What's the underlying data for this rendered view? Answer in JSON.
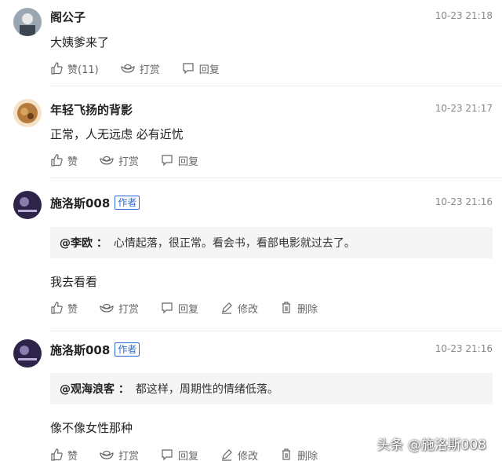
{
  "comments": [
    {
      "user": "阁公子",
      "time": "10-23 21:18",
      "text": "大姨爹来了",
      "actions": {
        "like": "赞(11)",
        "tip": "打赏",
        "reply": "回复"
      }
    },
    {
      "user": "年轻飞扬的背影",
      "time": "10-23 21:17",
      "text": "正常，人无远虑 必有近忧",
      "actions": {
        "like": "赞",
        "tip": "打赏",
        "reply": "回复"
      }
    },
    {
      "user": "施洛斯008",
      "badge": "作者",
      "time": "10-23 21:16",
      "quote_user": "@李欧 ：",
      "quote_text": "心情起落，很正常。看会书，看部电影就过去了。",
      "text": "我去看看",
      "actions": {
        "like": "赞",
        "tip": "打赏",
        "reply": "回复",
        "edit": "修改",
        "delete": "删除"
      }
    },
    {
      "user": "施洛斯008",
      "badge": "作者",
      "time": "10-23 21:16",
      "quote_user": "@观海浪客 ：",
      "quote_text": "都这样，周期性的情绪低落。",
      "text": "像不像女性那种",
      "actions": {
        "like": "赞",
        "tip": "打赏",
        "reply": "回复",
        "edit": "修改",
        "delete": "删除"
      }
    }
  ],
  "watermark": "头条 @施洛斯008",
  "colors": {
    "badge": "#2a6bd1",
    "quote_bg": "#f5f5f5",
    "time": "#888888",
    "action": "#666666"
  }
}
